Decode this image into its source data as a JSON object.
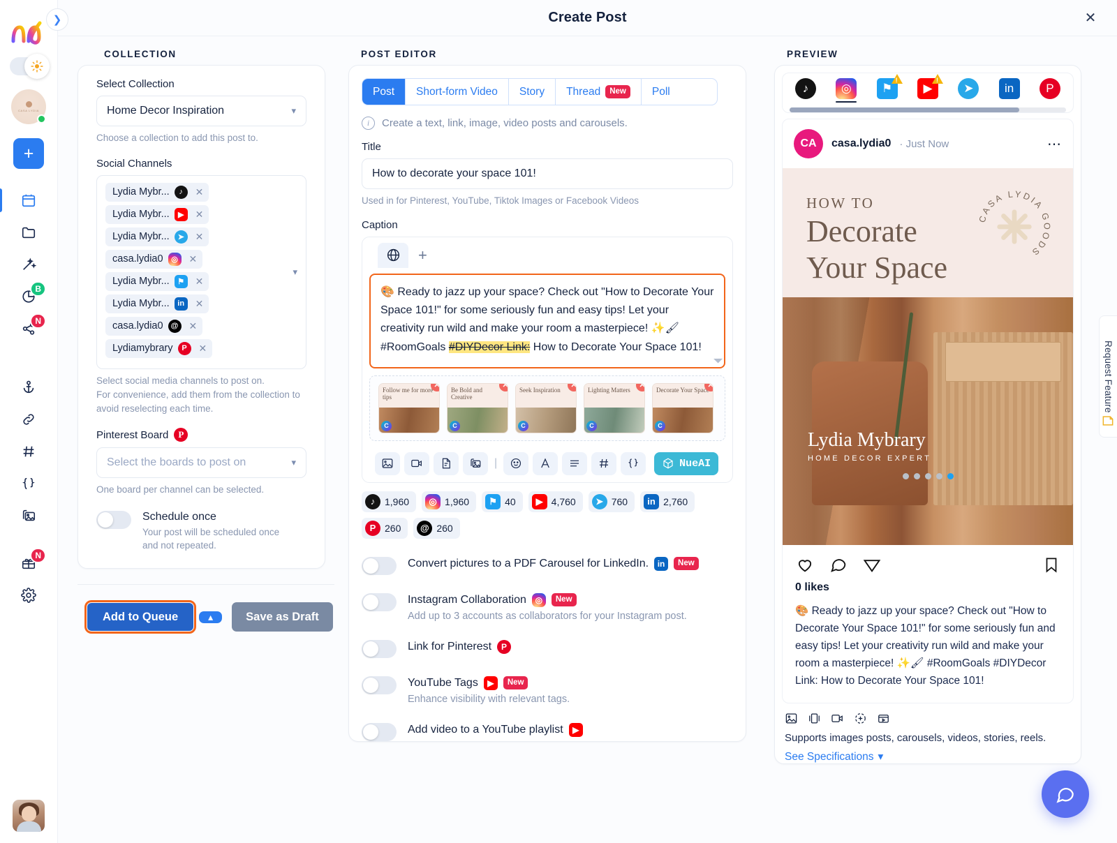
{
  "header": {
    "title": "Create Post",
    "close_icon": "close-icon"
  },
  "rail": {
    "collapse_icon": "chevron-right-icon",
    "logo": "nuelink-logo",
    "theme_toggle_icon": "sun-icon",
    "add_label": "+",
    "items": [
      {
        "name": "calendar",
        "icon": "calendar-icon",
        "badge": "",
        "active": true
      },
      {
        "name": "folder",
        "icon": "folder-icon",
        "badge": ""
      },
      {
        "name": "magic",
        "icon": "magic-wand-icon",
        "badge": ""
      },
      {
        "name": "analytics",
        "icon": "pie-chart-icon",
        "badge": "B"
      },
      {
        "name": "share",
        "icon": "share-icon",
        "badge": "N"
      },
      {
        "name": "anchor",
        "icon": "anchor-icon",
        "badge": ""
      },
      {
        "name": "links",
        "icon": "link-icon",
        "badge": ""
      },
      {
        "name": "hashtags",
        "icon": "hash-icon",
        "badge": ""
      },
      {
        "name": "variables",
        "icon": "braces-icon",
        "badge": ""
      },
      {
        "name": "media-library",
        "icon": "image-folder-icon",
        "badge": ""
      },
      {
        "name": "gifts",
        "icon": "gift-icon",
        "badge": "N"
      },
      {
        "name": "settings",
        "icon": "gear-icon",
        "badge": ""
      }
    ]
  },
  "collection": {
    "heading": "COLLECTION",
    "select_collection_label": "Select Collection",
    "selected_collection": "Home Decor Inspiration",
    "collection_help": "Choose a collection to add this post to.",
    "social_channels_label": "Social Channels",
    "channels": [
      {
        "name": "Lydia Mybr...",
        "platform": "tiktok"
      },
      {
        "name": "Lydia Mybr...",
        "platform": "youtube"
      },
      {
        "name": "Lydia Mybr...",
        "platform": "telegram"
      },
      {
        "name": "casa.lydia0",
        "platform": "instagram"
      },
      {
        "name": "Lydia Mybr...",
        "platform": "twitter"
      },
      {
        "name": "Lydia Mybr...",
        "platform": "linkedin"
      },
      {
        "name": "casa.lydia0",
        "platform": "threads"
      },
      {
        "name": "Lydiamybrary",
        "platform": "pinterest"
      }
    ],
    "channels_help_1": "Select social media channels to post on.",
    "channels_help_2": "For convenience, add them from the collection to avoid reselecting each time.",
    "pinterest_board_label": "Pinterest Board",
    "pinterest_board_placeholder": "Select the boards to post on",
    "pinterest_board_help": "One board per channel can be selected.",
    "schedule_once_label": "Schedule once",
    "schedule_once_help": "Your post will be scheduled once and not repeated.",
    "schedule_once_on": false
  },
  "footer": {
    "add_to_queue": "Add to Queue",
    "caret_icon": "chevron-up-icon",
    "save_as_draft": "Save as Draft",
    "highlight_color": "#f2651a"
  },
  "editor": {
    "heading": "POST EDITOR",
    "tabs": [
      {
        "label": "Post",
        "badge": "",
        "active": true
      },
      {
        "label": "Short-form Video",
        "badge": "",
        "active": false
      },
      {
        "label": "Story",
        "badge": "",
        "active": false
      },
      {
        "label": "Thread",
        "badge": "New",
        "active": false
      },
      {
        "label": "Poll",
        "badge": "",
        "active": false
      }
    ],
    "info_text": "Create a text, link, image, video posts and carousels.",
    "title_label": "Title",
    "title_value": "How to decorate your space 101!",
    "title_help": "Used in for Pinterest, YouTube, Tiktok Images or Facebook Videos",
    "caption_label": "Caption",
    "caption_tab_icon": "globe-icon",
    "caption_add_icon": "plus-icon",
    "caption_text_1": "🎨 Ready to jazz up your space? Check out \"How to Decorate Your Space 101!\" for some seriously fun and easy tips! Let your creativity run wild and make your room a masterpiece! ✨🖌 #RoomGoals ",
    "caption_text_highlighted": "#DIYDecor Link:",
    "caption_text_2": " How to Decorate Your Space 101!",
    "media": [
      {
        "title": "Follow me for more tips"
      },
      {
        "title": "Be Bold and Creative"
      },
      {
        "title": "Seek Inspiration"
      },
      {
        "title": "Lighting Matters"
      },
      {
        "title": "Decorate Your Space"
      }
    ],
    "toolbar": [
      {
        "name": "insert-image",
        "icon": "image-icon"
      },
      {
        "name": "insert-video",
        "icon": "video-icon"
      },
      {
        "name": "insert-document",
        "icon": "document-icon"
      },
      {
        "name": "media-library",
        "icon": "image-folder-icon"
      },
      {
        "name": "separator",
        "icon": "divider"
      },
      {
        "name": "emoji",
        "icon": "smiley-icon"
      },
      {
        "name": "font-style",
        "icon": "font-icon"
      },
      {
        "name": "align",
        "icon": "align-icon"
      },
      {
        "name": "hashtag",
        "icon": "hash-icon"
      },
      {
        "name": "variables",
        "icon": "braces-icon"
      }
    ],
    "ai_button": {
      "label": "NueAI",
      "icon": "cube-icon"
    },
    "counters": [
      {
        "platform": "tiktok",
        "value": "1,960"
      },
      {
        "platform": "instagram",
        "value": "1,960"
      },
      {
        "platform": "twitter",
        "value": "40"
      },
      {
        "platform": "youtube",
        "value": "4,760"
      },
      {
        "platform": "telegram",
        "value": "760"
      },
      {
        "platform": "linkedin",
        "value": "2,760"
      },
      {
        "platform": "pinterest",
        "value": "260"
      },
      {
        "platform": "threads",
        "value": "260"
      }
    ],
    "options": [
      {
        "label": "Convert pictures to a PDF Carousel for LinkedIn.",
        "platform": "linkedin",
        "badge": "New",
        "help": "",
        "on": false
      },
      {
        "label": "Instagram Collaboration",
        "platform": "instagram",
        "badge": "New",
        "help": "Add up to 3 accounts as collaborators for your Instagram post.",
        "on": false
      },
      {
        "label": "Link for Pinterest",
        "platform": "pinterest",
        "badge": "",
        "help": "",
        "on": false
      },
      {
        "label": "YouTube Tags",
        "platform": "youtube",
        "badge": "New",
        "help": "Enhance visibility with relevant tags.",
        "on": false
      },
      {
        "label": "Add video to a YouTube playlist",
        "platform": "youtube",
        "badge": "",
        "help": "",
        "on": false
      }
    ]
  },
  "preview": {
    "heading": "PREVIEW",
    "platforms": [
      {
        "name": "tiktok",
        "selected": false,
        "warning": false
      },
      {
        "name": "instagram",
        "selected": true,
        "warning": false
      },
      {
        "name": "twitter",
        "selected": false,
        "warning": true
      },
      {
        "name": "youtube",
        "selected": false,
        "warning": true
      },
      {
        "name": "telegram",
        "selected": false,
        "warning": false
      },
      {
        "name": "linkedin",
        "selected": false,
        "warning": false
      },
      {
        "name": "pinterest",
        "selected": false,
        "warning": false
      }
    ],
    "account_initials": "CA",
    "account_name": "casa.lydia0",
    "timestamp": "Just Now",
    "more_icon": "ellipsis-icon",
    "slide_kicker": "HOW TO",
    "slide_title_1": "Decorate",
    "slide_title_2": "Your Space",
    "seal_text": "CASA LYDIA GOODS",
    "brand_name": "Lydia Mybrary",
    "brand_sub": "HOME DECOR EXPERT",
    "carousel_dots": 5,
    "carousel_active": 5,
    "actions": [
      {
        "name": "like",
        "icon": "heart-icon"
      },
      {
        "name": "comment",
        "icon": "comment-icon"
      },
      {
        "name": "share",
        "icon": "send-icon"
      },
      {
        "name": "save",
        "icon": "bookmark-icon"
      }
    ],
    "likes": "0 likes",
    "caption": "🎨 Ready to jazz up your space? Check out \"How to Decorate Your Space 101!\" for some seriously fun and easy tips! Let your creativity run wild and make your room a masterpiece! ✨🖌 #RoomGoals #DIYDecor Link: How to Decorate Your Space 101!",
    "support_icons": [
      {
        "name": "image",
        "icon": "image-icon"
      },
      {
        "name": "carousel",
        "icon": "carousel-icon"
      },
      {
        "name": "video",
        "icon": "video-icon"
      },
      {
        "name": "story",
        "icon": "story-icon"
      },
      {
        "name": "reel",
        "icon": "reel-icon"
      }
    ],
    "support_text": "Supports images posts, carousels, videos, stories, reels.",
    "spec_link": "See Specifications",
    "prev_arrow": "chevron-left-icon",
    "next_arrow": "chevron-right-icon"
  },
  "side": {
    "request_feature": "Request Feature",
    "feedback_icon": "feedback-icon",
    "chat_icon": "chat-bubble-icon"
  }
}
